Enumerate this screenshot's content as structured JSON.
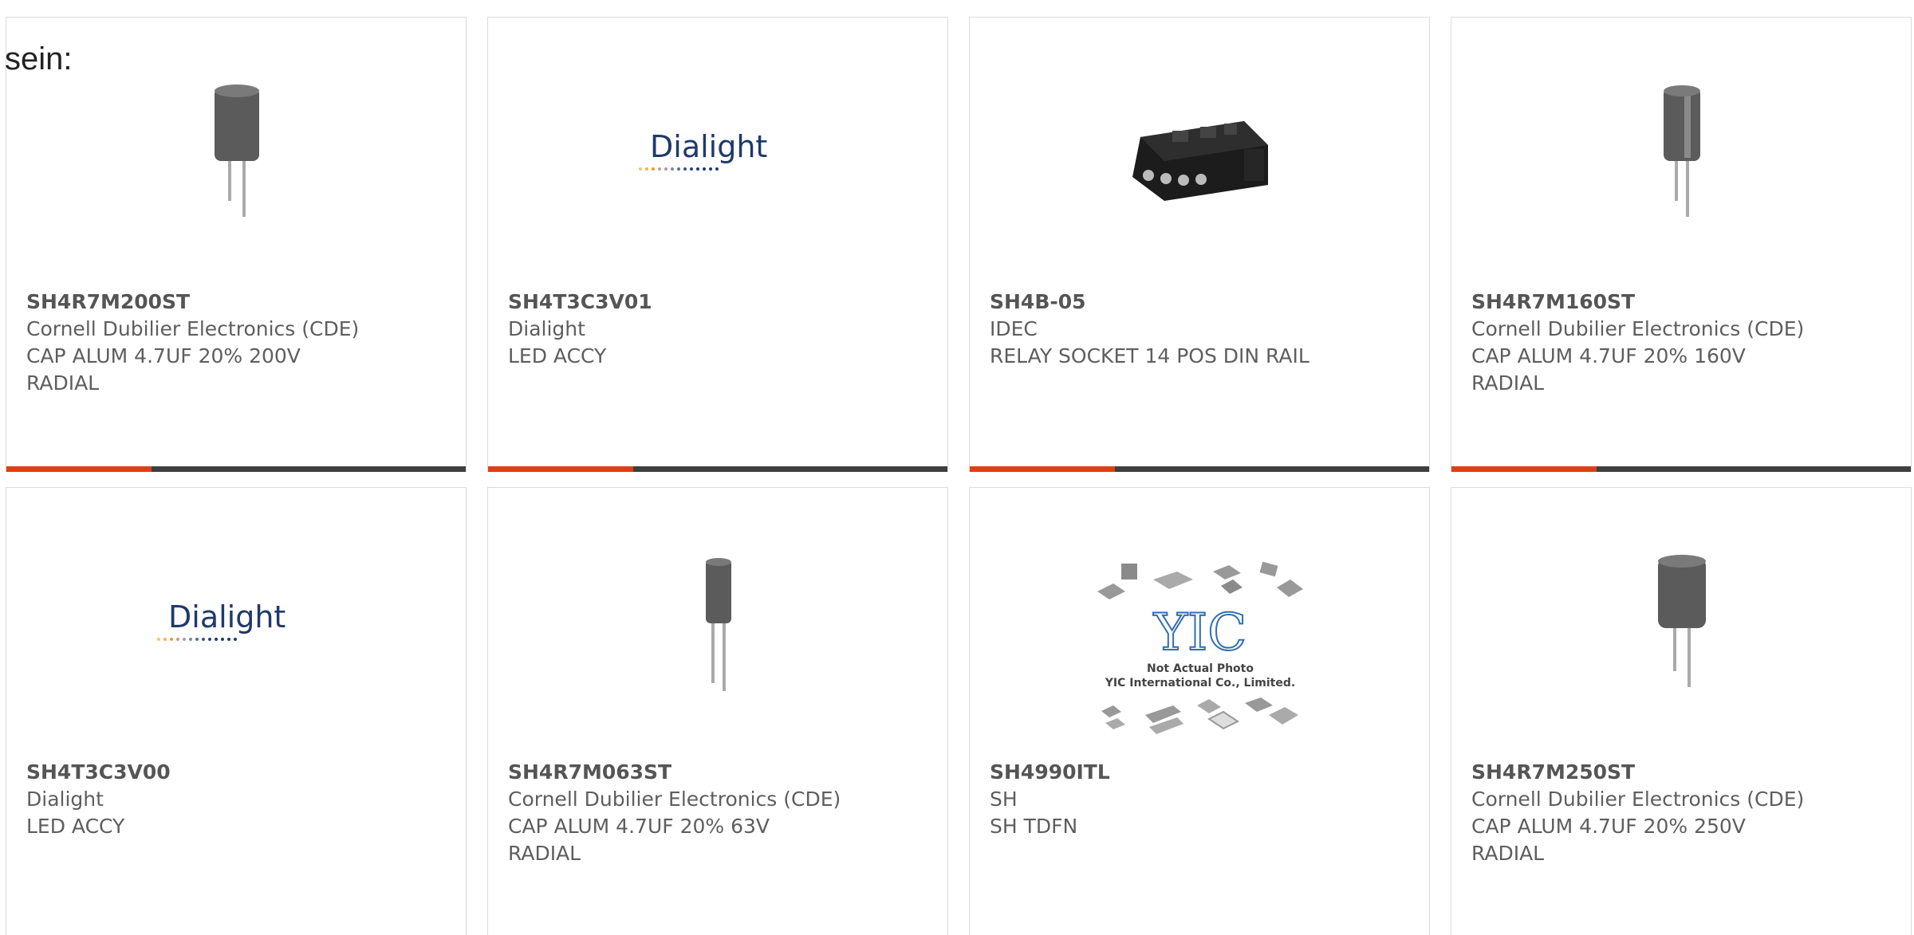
{
  "page": {
    "lead_text": "sein:"
  },
  "colors": {
    "accent": "#e23e13",
    "bar": "#3f3f3f",
    "text": "#5e5e5e"
  },
  "products": [
    {
      "part_number": "SH4R7M200ST",
      "manufacturer": "Cornell Dubilier Electronics (CDE)",
      "description": [
        "CAP ALUM 4.7UF 20% 200V",
        "RADIAL"
      ],
      "image_icon": "radial-capacitor-icon"
    },
    {
      "part_number": "SH4T3C3V01",
      "manufacturer": "Dialight",
      "description": [
        "LED ACCY"
      ],
      "image_icon": "dialight-logo",
      "logo_text": "Dialight"
    },
    {
      "part_number": "SH4B-05",
      "manufacturer": "IDEC",
      "description": [
        "RELAY SOCKET 14 POS DIN RAIL"
      ],
      "image_icon": "relay-socket-icon"
    },
    {
      "part_number": "SH4R7M160ST",
      "manufacturer": "Cornell Dubilier Electronics (CDE)",
      "description": [
        "CAP ALUM 4.7UF 20% 160V",
        "RADIAL"
      ],
      "image_icon": "radial-capacitor-icon"
    },
    {
      "part_number": "SH4T3C3V00",
      "manufacturer": "Dialight",
      "description": [
        "LED ACCY"
      ],
      "image_icon": "dialight-logo",
      "logo_text": "Dialight"
    },
    {
      "part_number": "SH4R7M063ST",
      "manufacturer": "Cornell Dubilier Electronics (CDE)",
      "description": [
        "CAP ALUM 4.7UF 20% 63V",
        "RADIAL"
      ],
      "image_icon": "radial-capacitor-icon"
    },
    {
      "part_number": "SH4990ITL",
      "manufacturer": "SH",
      "description": [
        "SH TDFN"
      ],
      "image_icon": "yic-placeholder-icon",
      "logo_text": "YIC",
      "image_caption": [
        "Not Actual Photo",
        "YIC International Co., Limited."
      ]
    },
    {
      "part_number": "SH4R7M250ST",
      "manufacturer": "Cornell Dubilier Electronics (CDE)",
      "description": [
        "CAP ALUM 4.7UF 20% 250V",
        "RADIAL"
      ],
      "image_icon": "radial-capacitor-icon"
    }
  ]
}
